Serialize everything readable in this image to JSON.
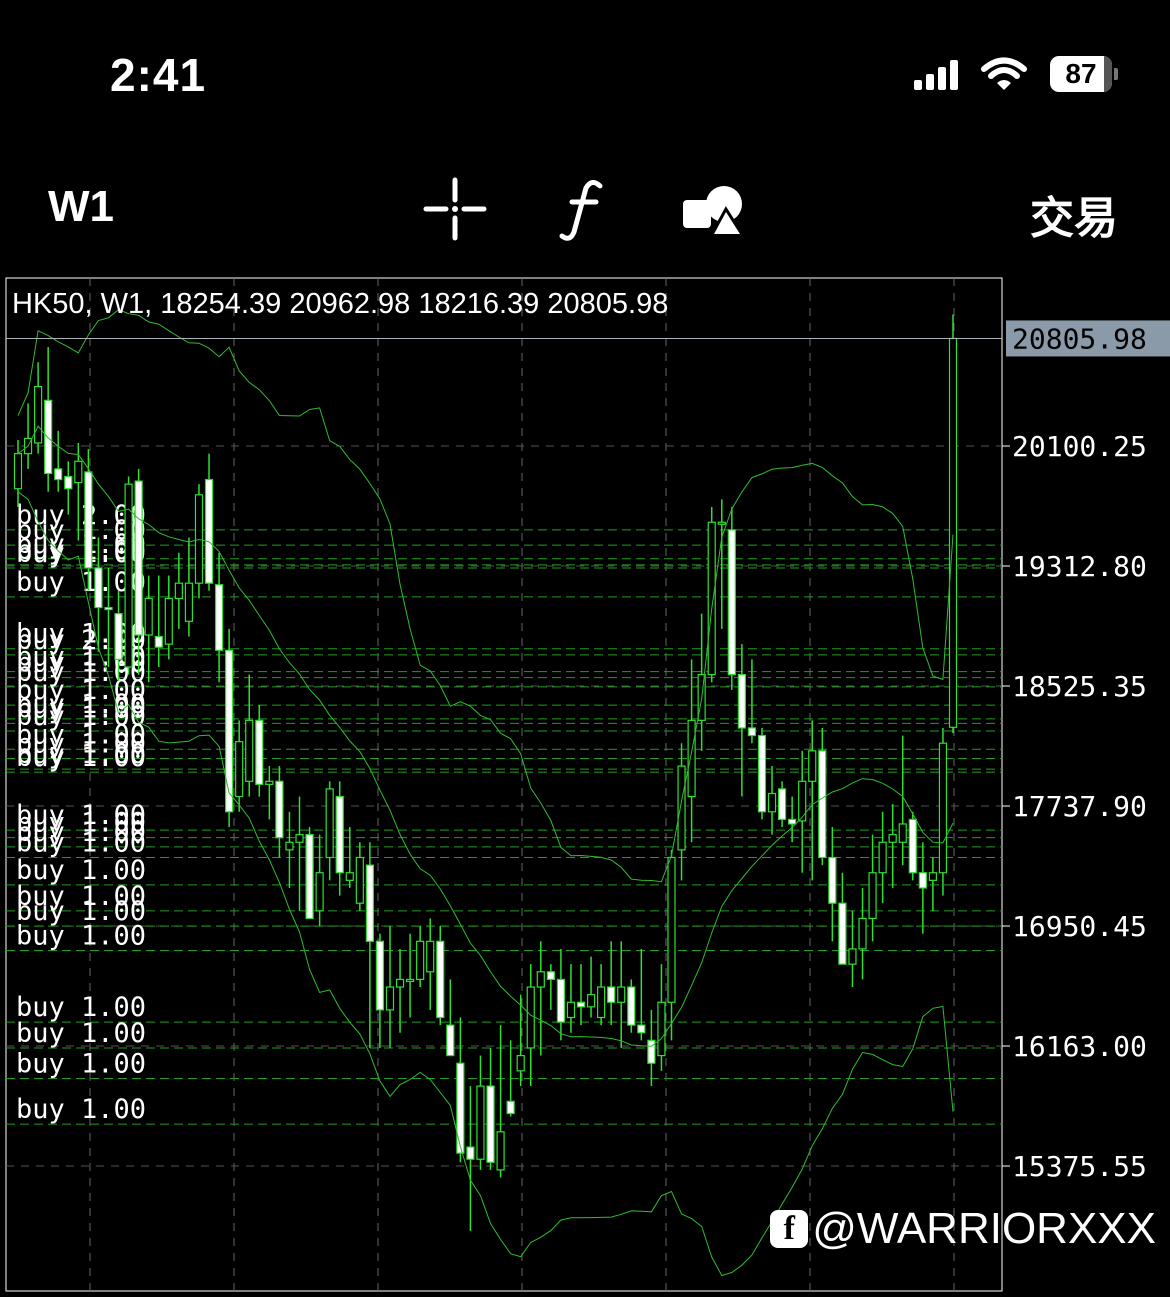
{
  "status_bar": {
    "time": "2:41",
    "battery": "87",
    "icons": [
      "signal-icon",
      "wifi-icon",
      "battery-icon"
    ]
  },
  "toolbar": {
    "timeframe": "W1",
    "tools": [
      "crosshair-icon",
      "function-icon",
      "shapes-icon"
    ],
    "trade_label": "交易"
  },
  "chart_header": {
    "symbol": "HK50",
    "timeframe": "W1",
    "open": "18254.39",
    "high": "20962.98",
    "low": "18216.39",
    "close": "20805.98"
  },
  "watermark": {
    "handle": "@WARRIORXXX",
    "icon": "facebook-icon"
  },
  "colors": {
    "candle_up": "#ffffff",
    "candle_border": "#2fe02f",
    "band": "#2fbd2f",
    "order_line": "#1f9e1f",
    "price_tag_bg": "#8a9aa8"
  },
  "chart_data": {
    "type": "candlestick",
    "symbol": "HK50",
    "timeframe": "W1",
    "y_ticks": [
      "20100.25",
      "19312.80",
      "18525.35",
      "17737.90",
      "16950.45",
      "16163.00",
      "15375.55"
    ],
    "ylim": [
      15000,
      21200
    ],
    "current_price": "20805.98",
    "current_price_label": "20805.98",
    "overlay": "bollinger bands",
    "candles": [
      {
        "o": 19820,
        "h": 20140,
        "l": 19700,
        "c": 20050
      },
      {
        "o": 20050,
        "h": 20380,
        "l": 19950,
        "c": 20150
      },
      {
        "o": 20120,
        "h": 20650,
        "l": 20050,
        "c": 20490
      },
      {
        "o": 20400,
        "h": 20750,
        "l": 19800,
        "c": 19920
      },
      {
        "o": 19950,
        "h": 20200,
        "l": 19800,
        "c": 19880
      },
      {
        "o": 19900,
        "h": 20000,
        "l": 19650,
        "c": 19820
      },
      {
        "o": 19860,
        "h": 20120,
        "l": 19480,
        "c": 20000
      },
      {
        "o": 19930,
        "h": 20080,
        "l": 19150,
        "c": 19300
      },
      {
        "o": 19300,
        "h": 19500,
        "l": 18750,
        "c": 19040
      },
      {
        "o": 19040,
        "h": 19300,
        "l": 18650,
        "c": 19030
      },
      {
        "o": 19000,
        "h": 19150,
        "l": 18560,
        "c": 18700
      },
      {
        "o": 18650,
        "h": 19900,
        "l": 18600,
        "c": 19850
      },
      {
        "o": 19870,
        "h": 19950,
        "l": 18600,
        "c": 18860
      },
      {
        "o": 18860,
        "h": 19250,
        "l": 18550,
        "c": 19100
      },
      {
        "o": 18850,
        "h": 19250,
        "l": 18650,
        "c": 18780
      },
      {
        "o": 18800,
        "h": 19250,
        "l": 18700,
        "c": 19100
      },
      {
        "o": 19100,
        "h": 19400,
        "l": 18900,
        "c": 19200
      },
      {
        "o": 18950,
        "h": 19500,
        "l": 18850,
        "c": 19200
      },
      {
        "o": 19200,
        "h": 19850,
        "l": 19100,
        "c": 19780
      },
      {
        "o": 19880,
        "h": 20050,
        "l": 19150,
        "c": 19200
      },
      {
        "o": 19190,
        "h": 19400,
        "l": 18550,
        "c": 18760
      },
      {
        "o": 18760,
        "h": 18900,
        "l": 17600,
        "c": 17700
      },
      {
        "o": 17800,
        "h": 18300,
        "l": 17700,
        "c": 18160
      },
      {
        "o": 17900,
        "h": 18600,
        "l": 17800,
        "c": 18300
      },
      {
        "o": 18300,
        "h": 18400,
        "l": 17800,
        "c": 17880
      },
      {
        "o": 17880,
        "h": 18000,
        "l": 17650,
        "c": 17900
      },
      {
        "o": 17900,
        "h": 18000,
        "l": 17400,
        "c": 17530
      },
      {
        "o": 17450,
        "h": 17700,
        "l": 17200,
        "c": 17500
      },
      {
        "o": 17500,
        "h": 17800,
        "l": 17050,
        "c": 17550
      },
      {
        "o": 17550,
        "h": 17600,
        "l": 17000,
        "c": 17000
      },
      {
        "o": 17050,
        "h": 17550,
        "l": 16950,
        "c": 17300
      },
      {
        "o": 17400,
        "h": 17900,
        "l": 17250,
        "c": 17850
      },
      {
        "o": 17800,
        "h": 17900,
        "l": 17150,
        "c": 17300
      },
      {
        "o": 17250,
        "h": 17600,
        "l": 17200,
        "c": 17300
      },
      {
        "o": 17100,
        "h": 17500,
        "l": 17050,
        "c": 17400
      },
      {
        "o": 17350,
        "h": 17500,
        "l": 16150,
        "c": 16850
      },
      {
        "o": 16850,
        "h": 16900,
        "l": 16150,
        "c": 16400
      },
      {
        "o": 16400,
        "h": 16950,
        "l": 16150,
        "c": 16550
      },
      {
        "o": 16550,
        "h": 16800,
        "l": 16250,
        "c": 16600
      },
      {
        "o": 16600,
        "h": 16900,
        "l": 16350,
        "c": 16600
      },
      {
        "o": 16600,
        "h": 16950,
        "l": 16550,
        "c": 16850
      },
      {
        "o": 16650,
        "h": 17000,
        "l": 16400,
        "c": 16850
      },
      {
        "o": 16850,
        "h": 16950,
        "l": 16300,
        "c": 16350
      },
      {
        "o": 16300,
        "h": 16600,
        "l": 16150,
        "c": 16100
      },
      {
        "o": 16050,
        "h": 16350,
        "l": 15400,
        "c": 15460
      },
      {
        "o": 15500,
        "h": 15900,
        "l": 14950,
        "c": 15420
      },
      {
        "o": 15420,
        "h": 16100,
        "l": 15350,
        "c": 15900
      },
      {
        "o": 15900,
        "h": 16150,
        "l": 15350,
        "c": 15400
      },
      {
        "o": 15350,
        "h": 16300,
        "l": 15300,
        "c": 15600
      },
      {
        "o": 15800,
        "h": 16200,
        "l": 15700,
        "c": 15720
      },
      {
        "o": 16000,
        "h": 16500,
        "l": 15900,
        "c": 16100
      },
      {
        "o": 16150,
        "h": 16700,
        "l": 15900,
        "c": 16550
      },
      {
        "o": 16550,
        "h": 16850,
        "l": 16100,
        "c": 16650
      },
      {
        "o": 16650,
        "h": 16700,
        "l": 16400,
        "c": 16600
      },
      {
        "o": 16600,
        "h": 16800,
        "l": 16200,
        "c": 16320
      },
      {
        "o": 16350,
        "h": 16700,
        "l": 16250,
        "c": 16450
      },
      {
        "o": 16450,
        "h": 16700,
        "l": 16300,
        "c": 16420
      },
      {
        "o": 16420,
        "h": 16750,
        "l": 16350,
        "c": 16500
      },
      {
        "o": 16350,
        "h": 16700,
        "l": 16300,
        "c": 16550
      },
      {
        "o": 16550,
        "h": 16850,
        "l": 16300,
        "c": 16450
      },
      {
        "o": 16450,
        "h": 16850,
        "l": 16150,
        "c": 16550
      },
      {
        "o": 16550,
        "h": 16600,
        "l": 16250,
        "c": 16300
      },
      {
        "o": 16300,
        "h": 16800,
        "l": 16200,
        "c": 16250
      },
      {
        "o": 16200,
        "h": 16400,
        "l": 15900,
        "c": 16050
      },
      {
        "o": 16100,
        "h": 16700,
        "l": 16000,
        "c": 16450
      },
      {
        "o": 16450,
        "h": 17450,
        "l": 16200,
        "c": 17400
      },
      {
        "o": 17450,
        "h": 18150,
        "l": 17250,
        "c": 18000
      },
      {
        "o": 17800,
        "h": 18700,
        "l": 17500,
        "c": 18300
      },
      {
        "o": 18300,
        "h": 19000,
        "l": 18100,
        "c": 18600
      },
      {
        "o": 18600,
        "h": 19700,
        "l": 18550,
        "c": 19600
      },
      {
        "o": 19600,
        "h": 19750,
        "l": 18900,
        "c": 19600
      },
      {
        "o": 19550,
        "h": 19700,
        "l": 18500,
        "c": 18600
      },
      {
        "o": 18600,
        "h": 18800,
        "l": 17800,
        "c": 18250
      },
      {
        "o": 18250,
        "h": 18700,
        "l": 18150,
        "c": 18200
      },
      {
        "o": 18200,
        "h": 18250,
        "l": 17650,
        "c": 17700
      },
      {
        "o": 17700,
        "h": 18000,
        "l": 17550,
        "c": 17820
      },
      {
        "o": 17850,
        "h": 17900,
        "l": 17600,
        "c": 17650
      },
      {
        "o": 17650,
        "h": 17800,
        "l": 17500,
        "c": 17620
      },
      {
        "o": 17640,
        "h": 18100,
        "l": 17300,
        "c": 17900
      },
      {
        "o": 17900,
        "h": 18300,
        "l": 17250,
        "c": 18100
      },
      {
        "o": 18100,
        "h": 18250,
        "l": 17350,
        "c": 17400
      },
      {
        "o": 17400,
        "h": 17600,
        "l": 16850,
        "c": 17100
      },
      {
        "o": 17100,
        "h": 17300,
        "l": 16700,
        "c": 16700
      },
      {
        "o": 16700,
        "h": 17050,
        "l": 16550,
        "c": 16800
      },
      {
        "o": 16800,
        "h": 17200,
        "l": 16600,
        "c": 17000
      },
      {
        "o": 17000,
        "h": 17550,
        "l": 16850,
        "c": 17300
      },
      {
        "o": 17300,
        "h": 17700,
        "l": 17100,
        "c": 17500
      },
      {
        "o": 17500,
        "h": 17750,
        "l": 17200,
        "c": 17550
      },
      {
        "o": 17500,
        "h": 18200,
        "l": 17350,
        "c": 17620
      },
      {
        "o": 17650,
        "h": 17700,
        "l": 17250,
        "c": 17300
      },
      {
        "o": 17300,
        "h": 17500,
        "l": 16900,
        "c": 17200
      },
      {
        "o": 17250,
        "h": 17400,
        "l": 17050,
        "c": 17300
      },
      {
        "o": 17300,
        "h": 18250,
        "l": 17150,
        "c": 18150
      },
      {
        "o": 18254.39,
        "h": 20962.98,
        "l": 18216.39,
        "c": 20805.98
      }
    ],
    "order_lines": [
      {
        "label": "buy 2.00",
        "price": 19550
      },
      {
        "label": "buy 1.00",
        "price": 19450
      },
      {
        "label": "buy 1.00",
        "price": 19360
      },
      {
        "label": "buy 1.00",
        "price": 19320
      },
      {
        "label": "buy 1.00",
        "price": 19300
      },
      {
        "label": "buy 1.00",
        "price": 19110
      },
      {
        "label": "buy 1.00",
        "price": 18770
      },
      {
        "label": "buy 2.00",
        "price": 18730
      },
      {
        "label": "buy 1.00",
        "price": 18620
      },
      {
        "label": "buy 1.00",
        "price": 18580
      },
      {
        "label": "buy 1.00",
        "price": 18520
      },
      {
        "label": "buy 1.00",
        "price": 18400
      },
      {
        "label": "buy 1.00",
        "price": 18310
      },
      {
        "label": "buy 1.00",
        "price": 18280
      },
      {
        "label": "buy 1.00",
        "price": 18230
      },
      {
        "label": "buy 1.00",
        "price": 18110
      },
      {
        "label": "buy 1.00",
        "price": 18050
      },
      {
        "label": "buy 1.00",
        "price": 17980
      },
      {
        "label": "buy 1.00",
        "price": 17960
      },
      {
        "label": "buy 1.00",
        "price": 17580
      },
      {
        "label": "buy 1.00",
        "price": 17530
      },
      {
        "label": "buy 1.00",
        "price": 17470
      },
      {
        "label": "buy 1.00",
        "price": 17400
      },
      {
        "label": "buy 1.00",
        "price": 17220
      },
      {
        "label": "buy 1.00",
        "price": 17050
      },
      {
        "label": "buy 1.00",
        "price": 16950
      },
      {
        "label": "buy 1.00",
        "price": 16790
      },
      {
        "label": "buy 1.00",
        "price": 16320
      },
      {
        "label": "buy 1.00",
        "price": 16150
      },
      {
        "label": "buy 1.00",
        "price": 15950
      },
      {
        "label": "buy 1.00",
        "price": 15650
      }
    ]
  }
}
